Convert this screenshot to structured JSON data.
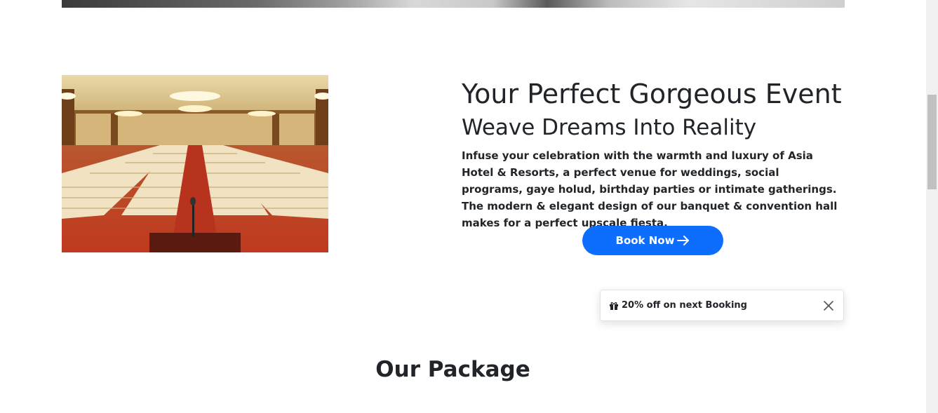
{
  "event_section": {
    "image_alt": "banquet hall",
    "title": "Your Perfect Gorgeous Event",
    "subtitle": "Weave Dreams Into Reality",
    "description": "Infuse your celebration with the warmth and luxury of Asia Hotel & Resorts, a perfect venue for weddings, social programs, gaye holud, birthday parties or intimate gatherings. The modern & elegant design of our banquet & convention hall makes for a perfect upscale fiesta.",
    "book_button": {
      "label": "Book Now",
      "icon": "arrow-right-icon",
      "color": "#0d6efd"
    }
  },
  "toast": {
    "icon": "gift-icon",
    "text": "20% off on next Booking",
    "close_icon": "close-icon"
  },
  "package_section": {
    "title": "Our Package"
  }
}
